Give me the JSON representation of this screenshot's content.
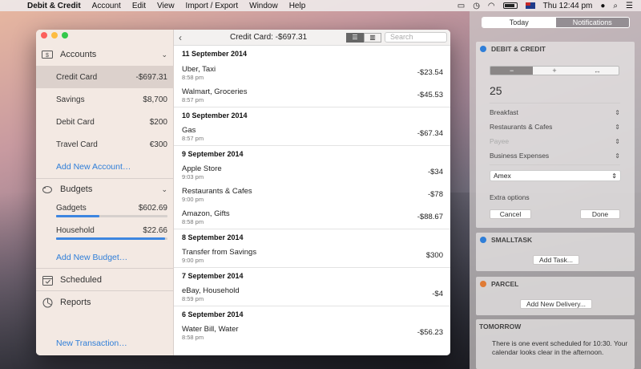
{
  "menubar": {
    "app_name": "Debit & Credit",
    "menus": [
      "Account",
      "Edit",
      "View",
      "Import / Export",
      "Window",
      "Help"
    ],
    "clock": "Thu 12:44 pm"
  },
  "sidebar": {
    "accounts_label": "Accounts",
    "accounts": [
      {
        "name": "Credit Card",
        "amount": "-$697.31",
        "selected": true
      },
      {
        "name": "Savings",
        "amount": "$8,700",
        "selected": false
      },
      {
        "name": "Debit Card",
        "amount": "$200",
        "selected": false
      },
      {
        "name": "Travel Card",
        "amount": "€300",
        "selected": false
      }
    ],
    "add_account": "Add New Account…",
    "budgets_label": "Budgets",
    "budgets": [
      {
        "name": "Gadgets",
        "amount": "$602.69",
        "progress": 0.39
      },
      {
        "name": "Household",
        "amount": "$22.66",
        "progress": 0.98
      }
    ],
    "add_budget": "Add New Budget…",
    "scheduled_label": "Scheduled",
    "reports_label": "Reports",
    "new_transaction": "New Transaction…"
  },
  "toolbar": {
    "title": "Credit Card: -$697.31",
    "search_placeholder": "Search"
  },
  "transactions": [
    {
      "date": "11 September 2014",
      "items": [
        {
          "name": "Uber, Taxi",
          "time": "8:58 pm",
          "amount": "-$23.54"
        },
        {
          "name": "Walmart, Groceries",
          "time": "8:57 pm",
          "amount": "-$45.53"
        }
      ]
    },
    {
      "date": "10 September 2014",
      "items": [
        {
          "name": "Gas",
          "time": "8:57 pm",
          "amount": "-$67.34"
        }
      ]
    },
    {
      "date": "9 September 2014",
      "items": [
        {
          "name": "Apple Store",
          "time": "9:03 pm",
          "amount": "-$34"
        },
        {
          "name": "Restaurants & Cafes",
          "time": "9:00 pm",
          "amount": "-$78"
        },
        {
          "name": "Amazon, Gifts",
          "time": "8:58 pm",
          "amount": "-$88.67"
        }
      ]
    },
    {
      "date": "8 September 2014",
      "items": [
        {
          "name": "Transfer from Savings",
          "time": "9:00 pm",
          "amount": "$300"
        }
      ]
    },
    {
      "date": "7 September 2014",
      "items": [
        {
          "name": "eBay, Household",
          "time": "8:59 pm",
          "amount": "-$4"
        }
      ]
    },
    {
      "date": "6 September 2014",
      "items": [
        {
          "name": "Water Bill, Water",
          "time": "8:58 pm",
          "amount": "-$56.23"
        }
      ]
    }
  ],
  "notification_center": {
    "tabs": [
      "Today",
      "Notifications"
    ],
    "active_tab": "Today",
    "debit_credit": {
      "title": "DEBIT & CREDIT",
      "segments": [
        "−",
        "+",
        "↔"
      ],
      "amount": "25",
      "rows": [
        "Breakfast",
        "Restaurants & Cafes",
        "Payee",
        "Business Expenses"
      ],
      "account_select": "Amex",
      "extra_options": "Extra options",
      "cancel": "Cancel",
      "done": "Done"
    },
    "smalltask": {
      "title": "SMALLTASK",
      "button": "Add Task..."
    },
    "parcel": {
      "title": "PARCEL",
      "button": "Add New Delivery..."
    },
    "tomorrow": {
      "title": "TOMORROW",
      "text": "There is one event scheduled for 10:30. Your calendar looks clear in the afternoon."
    }
  },
  "colors": {
    "accent_blue": "#2f7ed8",
    "budget_bar": "#3d86e0",
    "debit_credit_dot": "#2f7ed8",
    "smalltask_dot": "#2f7ed8",
    "parcel_dot": "#e07b35"
  }
}
